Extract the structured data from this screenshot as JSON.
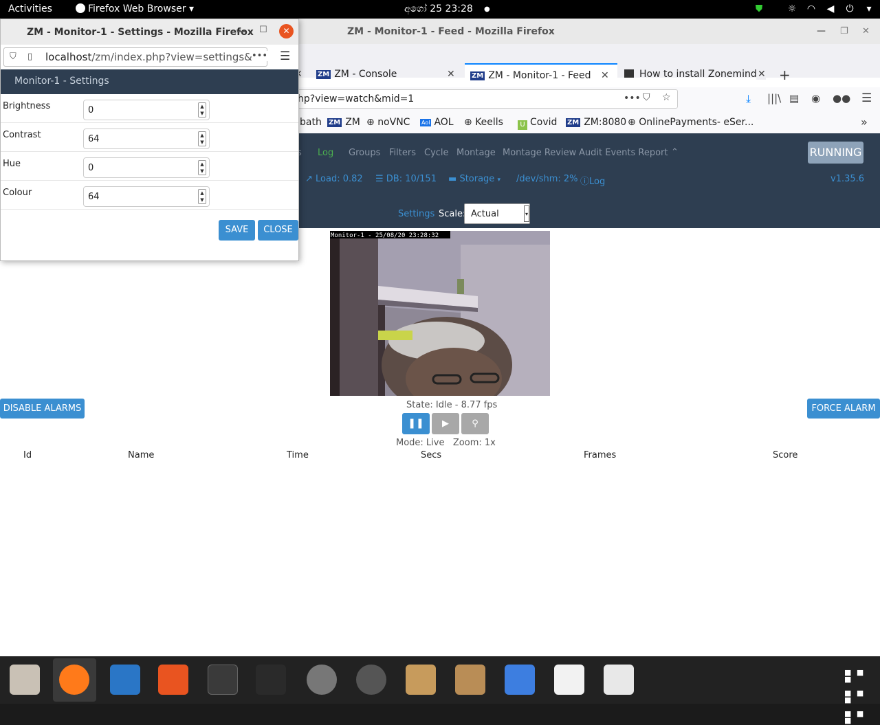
{
  "topbar": {
    "activities": "Activities",
    "app_menu": "Firefox Web Browser",
    "clock": "අගෝ 25  23:28"
  },
  "main_window": {
    "title": "ZM - Monitor-1 - Feed - Mozilla Firefox",
    "tabs": [
      {
        "label": "ZM - Console"
      },
      {
        "label": "ZM - Monitor-1 - Feed"
      },
      {
        "label": "How to install Zonemind"
      }
    ],
    "url": "hp?view=watch&mid=1",
    "bookmarks": [
      "bath",
      "ZM",
      "noVNC",
      "AOL",
      "Keells",
      "Covid",
      "ZM:8080",
      "OnlinePayments- eSer..."
    ]
  },
  "zm": {
    "menu": [
      "Log",
      "Groups",
      "Filters",
      "Cycle",
      "Montage",
      "Montage Review",
      "Audit Events Report"
    ],
    "status": {
      "load": "Load: 0.82",
      "db": "DB: 10/151",
      "storage": "Storage",
      "shm": "/dev/shm: 2%",
      "log": "Log",
      "version": "v1.35.6"
    },
    "running": "RUNNING",
    "settings_link": "Settings",
    "scale_label": "Scale:",
    "scale_value": "Actual",
    "feed_overlay": "Monitor-1 - 25/08/20 23:28:32",
    "state": "State: Idle - 8.77 fps",
    "mode": "Mode: Live   Zoom: 1x",
    "disable_alarms": "DISABLE ALARMS",
    "force_alarm": "FORCE ALARM",
    "columns": [
      "Id",
      "Name",
      "Time",
      "Secs",
      "Frames",
      "Score"
    ]
  },
  "popup": {
    "title": "ZM - Monitor-1 - Settings - Mozilla Firefox",
    "url_host": "localhost",
    "url_path": "/zm/index.php?view=settings&mi",
    "header": "Monitor-1 - Settings",
    "fields": [
      {
        "label": "Brightness",
        "value": "0"
      },
      {
        "label": "Contrast",
        "value": "64"
      },
      {
        "label": "Hue",
        "value": "0"
      },
      {
        "label": "Colour",
        "value": "64"
      }
    ],
    "save": "SAVE",
    "close": "CLOSE"
  }
}
